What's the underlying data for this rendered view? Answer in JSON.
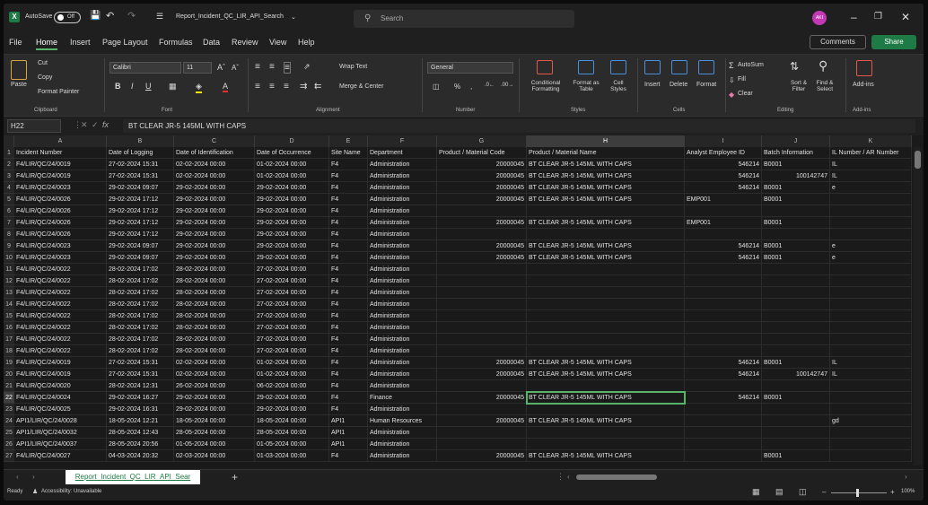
{
  "titlebar": {
    "autosave_label": "AutoSave",
    "autosave_state": "Off",
    "filename": "Report_Incident_QC_LIR_API_Search",
    "search_placeholder": "Search",
    "user_initials": "AKI"
  },
  "menu": [
    "File",
    "Home",
    "Insert",
    "Page Layout",
    "Formulas",
    "Data",
    "Review",
    "View",
    "Help"
  ],
  "menu_active": "Home",
  "actions": {
    "comments": "Comments",
    "share": "Share"
  },
  "ribbon": {
    "clipboard": {
      "paste": "Paste",
      "cut": "Cut",
      "copy": "Copy",
      "format_painter": "Format Painter",
      "group": "Clipboard"
    },
    "font": {
      "name": "Calibri",
      "size": "11",
      "group": "Font"
    },
    "alignment": {
      "wrap": "Wrap Text",
      "merge": "Merge & Center",
      "group": "Alignment"
    },
    "number": {
      "format": "General",
      "group": "Number"
    },
    "styles": {
      "conditional": "Conditional Formatting",
      "table": "Format as Table",
      "cell": "Cell Styles",
      "group": "Styles"
    },
    "cells": {
      "insert": "Insert",
      "delete": "Delete",
      "format": "Format",
      "group": "Cells"
    },
    "editing": {
      "autosum": "AutoSum",
      "fill": "Fill",
      "clear": "Clear",
      "sort": "Sort & Filter",
      "find": "Find & Select",
      "group": "Editing"
    },
    "addins": {
      "label": "Add-ins",
      "group": "Add-ins"
    }
  },
  "formula_bar": {
    "namebox": "H22",
    "fx": "fx",
    "value": "BT CLEAR JR-5 145ML WITH CAPS"
  },
  "columns": [
    {
      "letter": "A",
      "w": 103
    },
    {
      "letter": "B",
      "w": 75
    },
    {
      "letter": "C",
      "w": 90
    },
    {
      "letter": "D",
      "w": 83
    },
    {
      "letter": "E",
      "w": 43
    },
    {
      "letter": "F",
      "w": 77
    },
    {
      "letter": "G",
      "w": 100
    },
    {
      "letter": "H",
      "w": 176
    },
    {
      "letter": "I",
      "w": 86
    },
    {
      "letter": "J",
      "w": 76
    },
    {
      "letter": "K",
      "w": 91
    }
  ],
  "selected_col": "H",
  "selected_row": 22,
  "rows": [
    [
      "Incident Number",
      "Date of Logging",
      "Date of Identification",
      "Date of Occurrence",
      "Site Name",
      "Department",
      "Product / Material Code",
      "Product / Material Name",
      "Analyst Employee ID",
      "Batch Information",
      "IL Number / AR Number"
    ],
    [
      "F4/LIR/QC/24/0019",
      "27-02-2024 15:31",
      "02-02-2024 00:00",
      "01-02-2024 00:00",
      "F4",
      "Administration",
      "20000045",
      "BT CLEAR JR-5 145ML WITH CAPS",
      "546214",
      "B0001",
      "IL"
    ],
    [
      "F4/LIR/QC/24/0019",
      "27-02-2024 15:31",
      "02-02-2024 00:00",
      "01-02-2024 00:00",
      "F4",
      "Administration",
      "20000045",
      "BT CLEAR JR-5 145ML WITH CAPS",
      "546214",
      "100142747",
      "IL"
    ],
    [
      "F4/LIR/QC/24/0023",
      "29-02-2024 09:07",
      "29-02-2024 00:00",
      "29-02-2024 00:00",
      "F4",
      "Administration",
      "20000045",
      "BT CLEAR JR-5 145ML WITH CAPS",
      "546214",
      "B0001",
      "e"
    ],
    [
      "F4/LIR/QC/24/0026",
      "29-02-2024 17:12",
      "29-02-2024 00:00",
      "29-02-2024 00:00",
      "F4",
      "Administration",
      "20000045",
      "BT CLEAR JR-5 145ML WITH CAPS",
      "EMP001",
      "B0001",
      ""
    ],
    [
      "F4/LIR/QC/24/0026",
      "29-02-2024 17:12",
      "29-02-2024 00:00",
      "29-02-2024 00:00",
      "F4",
      "Administration",
      "",
      "",
      "",
      "",
      ""
    ],
    [
      "F4/LIR/QC/24/0026",
      "29-02-2024 17:12",
      "29-02-2024 00:00",
      "29-02-2024 00:00",
      "F4",
      "Administration",
      "20000045",
      "BT CLEAR JR-5 145ML WITH CAPS",
      "EMP001",
      "B0001",
      ""
    ],
    [
      "F4/LIR/QC/24/0026",
      "29-02-2024 17:12",
      "29-02-2024 00:00",
      "29-02-2024 00:00",
      "F4",
      "Administration",
      "",
      "",
      "",
      "",
      ""
    ],
    [
      "F4/LIR/QC/24/0023",
      "29-02-2024 09:07",
      "29-02-2024 00:00",
      "29-02-2024 00:00",
      "F4",
      "Administration",
      "20000045",
      "BT CLEAR JR-5 145ML WITH CAPS",
      "546214",
      "B0001",
      "e"
    ],
    [
      "F4/LIR/QC/24/0023",
      "29-02-2024 09:07",
      "29-02-2024 00:00",
      "29-02-2024 00:00",
      "F4",
      "Administration",
      "20000045",
      "BT CLEAR JR-5 145ML WITH CAPS",
      "546214",
      "B0001",
      "e"
    ],
    [
      "F4/LIR/QC/24/0022",
      "28-02-2024 17:02",
      "28-02-2024 00:00",
      "27-02-2024 00:00",
      "F4",
      "Administration",
      "",
      "",
      "",
      "",
      ""
    ],
    [
      "F4/LIR/QC/24/0022",
      "28-02-2024 17:02",
      "28-02-2024 00:00",
      "27-02-2024 00:00",
      "F4",
      "Administration",
      "",
      "",
      "",
      "",
      ""
    ],
    [
      "F4/LIR/QC/24/0022",
      "28-02-2024 17:02",
      "28-02-2024 00:00",
      "27-02-2024 00:00",
      "F4",
      "Administration",
      "",
      "",
      "",
      "",
      ""
    ],
    [
      "F4/LIR/QC/24/0022",
      "28-02-2024 17:02",
      "28-02-2024 00:00",
      "27-02-2024 00:00",
      "F4",
      "Administration",
      "",
      "",
      "",
      "",
      ""
    ],
    [
      "F4/LIR/QC/24/0022",
      "28-02-2024 17:02",
      "28-02-2024 00:00",
      "27-02-2024 00:00",
      "F4",
      "Administration",
      "",
      "",
      "",
      "",
      ""
    ],
    [
      "F4/LIR/QC/24/0022",
      "28-02-2024 17:02",
      "28-02-2024 00:00",
      "27-02-2024 00:00",
      "F4",
      "Administration",
      "",
      "",
      "",
      "",
      ""
    ],
    [
      "F4/LIR/QC/24/0022",
      "28-02-2024 17:02",
      "28-02-2024 00:00",
      "27-02-2024 00:00",
      "F4",
      "Administration",
      "",
      "",
      "",
      "",
      ""
    ],
    [
      "F4/LIR/QC/24/0022",
      "28-02-2024 17:02",
      "28-02-2024 00:00",
      "27-02-2024 00:00",
      "F4",
      "Administration",
      "",
      "",
      "",
      "",
      ""
    ],
    [
      "F4/LIR/QC/24/0019",
      "27-02-2024 15:31",
      "02-02-2024 00:00",
      "01-02-2024 00:00",
      "F4",
      "Administration",
      "20000045",
      "BT CLEAR JR-5 145ML WITH CAPS",
      "546214",
      "B0001",
      "IL"
    ],
    [
      "F4/LIR/QC/24/0019",
      "27-02-2024 15:31",
      "02-02-2024 00:00",
      "01-02-2024 00:00",
      "F4",
      "Administration",
      "20000045",
      "BT CLEAR JR-5 145ML WITH CAPS",
      "546214",
      "100142747",
      "IL"
    ],
    [
      "F4/LIR/QC/24/0020",
      "28-02-2024 12:31",
      "26-02-2024 00:00",
      "06-02-2024 00:00",
      "F4",
      "Administration",
      "",
      "",
      "",
      "",
      ""
    ],
    [
      "F4/LIR/QC/24/0024",
      "29-02-2024 16:27",
      "29-02-2024 00:00",
      "29-02-2024 00:00",
      "F4",
      "Finance",
      "20000045",
      "BT CLEAR JR-5 145ML WITH CAPS",
      "546214",
      "B0001",
      ""
    ],
    [
      "F4/LIR/QC/24/0025",
      "29-02-2024 16:31",
      "29-02-2024 00:00",
      "29-02-2024 00:00",
      "F4",
      "Administration",
      "",
      "",
      "",
      "",
      ""
    ],
    [
      "API1/LIR/QC/24/0028",
      "18-05-2024 12:21",
      "18-05-2024 00:00",
      "18-05-2024 00:00",
      "API1",
      "Human Resources",
      "20000045",
      "BT CLEAR JR-5 145ML WITH CAPS",
      "",
      "",
      "gd"
    ],
    [
      "API1/LIR/QC/24/0032",
      "28-05-2024 12:43",
      "28-05-2024 00:00",
      "28-05-2024 00:00",
      "API1",
      "Administration",
      "",
      "",
      "",
      "",
      ""
    ],
    [
      "API1/LIR/QC/24/0037",
      "28-05-2024 20:56",
      "01-05-2024 00:00",
      "01-05-2024 00:00",
      "API1",
      "Administration",
      "",
      "",
      "",
      "",
      ""
    ],
    [
      "F4/LIR/QC/24/0027",
      "04-03-2024 20:32",
      "02-03-2024 00:00",
      "01-03-2024 00:00",
      "F4",
      "Administration",
      "20000045",
      "BT CLEAR JR-5 145ML WITH CAPS",
      "",
      "B0001",
      ""
    ]
  ],
  "sheet_tab": "Report_Incident_QC_LIR_API_Sear",
  "status": {
    "ready": "Ready",
    "accessibility": "Accessibility: Unavailable",
    "zoom": "100%"
  }
}
